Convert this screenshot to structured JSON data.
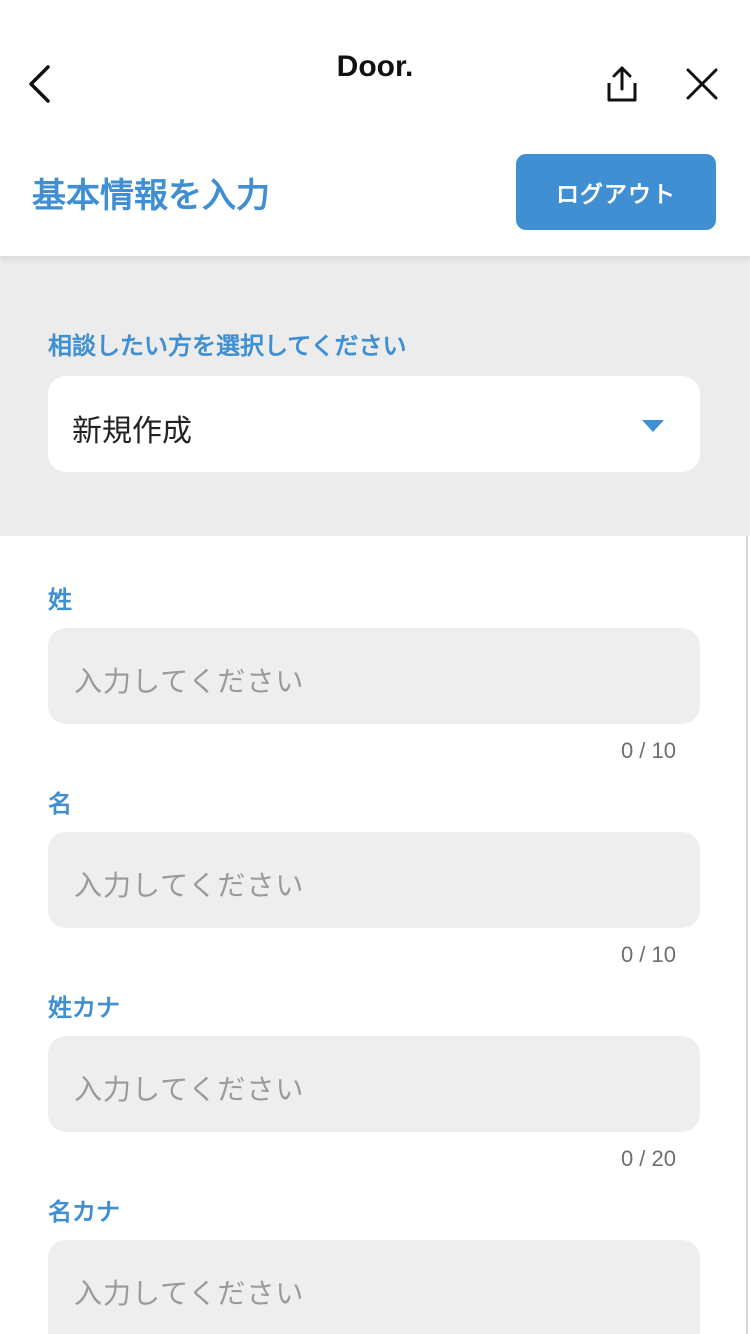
{
  "nav": {
    "title": "Door.",
    "back_icon": "chevron-left-icon",
    "share_icon": "share-icon",
    "close_icon": "close-icon"
  },
  "header": {
    "title": "基本情報を入力",
    "logout_label": "ログアウト"
  },
  "consult": {
    "label": "相談したい方を選択してください",
    "selected": "新規作成",
    "arrow_icon": "caret-down-icon"
  },
  "fields": [
    {
      "label": "姓",
      "placeholder": "入力してください",
      "count": "0 / 10"
    },
    {
      "label": "名",
      "placeholder": "入力してください",
      "count": "0 / 10"
    },
    {
      "label": "姓カナ",
      "placeholder": "入力してください",
      "count": "0 / 20"
    },
    {
      "label": "名カナ",
      "placeholder": "入力してください"
    }
  ],
  "colors": {
    "accent": "#3f8fd2",
    "section_bg": "#ececec",
    "input_bg": "#eeeeee"
  }
}
